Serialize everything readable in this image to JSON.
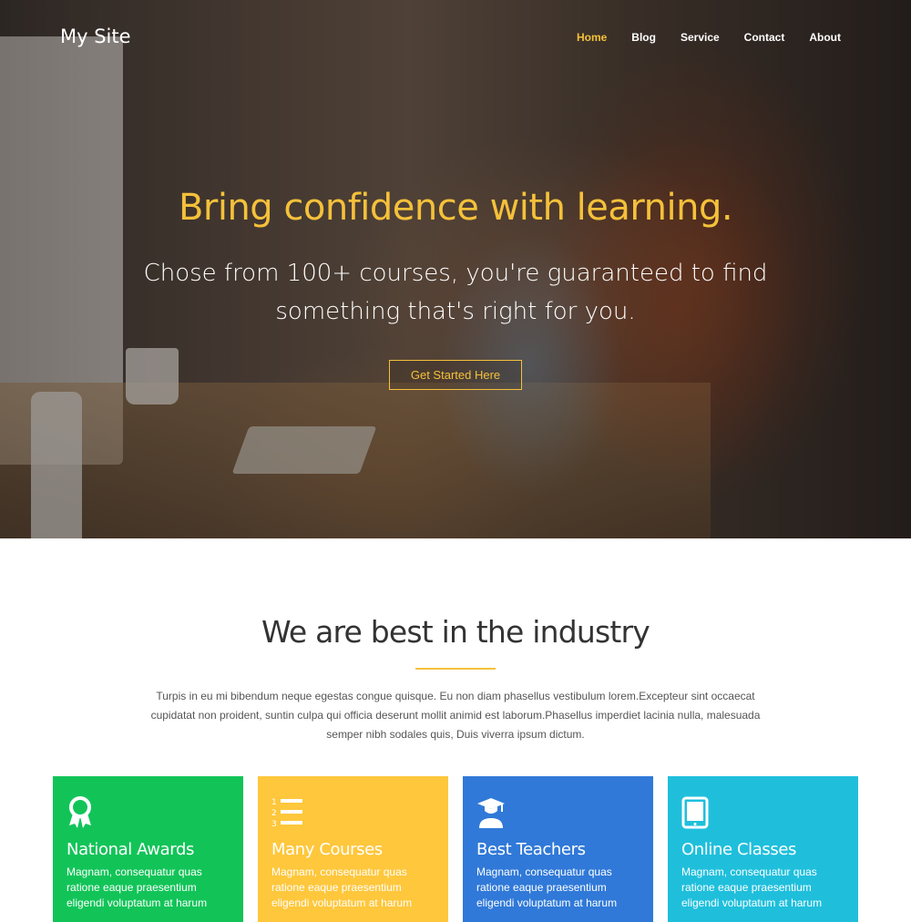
{
  "brand": "My Site",
  "nav": {
    "items": [
      {
        "label": "Home",
        "active": true
      },
      {
        "label": "Blog",
        "active": false
      },
      {
        "label": "Service",
        "active": false
      },
      {
        "label": "Contact",
        "active": false
      },
      {
        "label": "About",
        "active": false
      }
    ]
  },
  "hero": {
    "title": "Bring confidence with learning.",
    "subtitle": "Chose from 100+ courses, you're guaranteed to find something that's right for you.",
    "cta_label": "Get Started Here"
  },
  "intro": {
    "title": "We are best in the industry",
    "text": "Turpis in eu mi bibendum neque egestas congue quisque. Eu non diam phasellus vestibulum lorem.Excepteur sint occaecat cupidatat non proident, suntin culpa qui officia deserunt mollit animid est laborum.Phasellus imperdiet lacinia nulla, malesuada semper nibh sodales quis, Duis viverra ipsum dictum."
  },
  "cards": [
    {
      "icon": "award-icon",
      "title": "National Awards",
      "text": "Magnam, consequatur quas ratione eaque praesentium eligendi voluptatum at harum",
      "color": "#12c458"
    },
    {
      "icon": "list-ordered-icon",
      "title": "Many Courses",
      "text": "Magnam, consequatur quas ratione eaque praesentium eligendi voluptatum at harum",
      "color": "#fec73c"
    },
    {
      "icon": "graduate-icon",
      "title": "Best Teachers",
      "text": "Magnam, consequatur quas ratione eaque praesentium eligendi voluptatum at harum",
      "color": "#3079d8"
    },
    {
      "icon": "tablet-icon",
      "title": "Online Classes",
      "text": "Magnam, consequatur quas ratione eaque praesentium eligendi voluptatum at harum",
      "color": "#1fbfdc"
    }
  ],
  "colors": {
    "accent": "#f5c13a"
  }
}
